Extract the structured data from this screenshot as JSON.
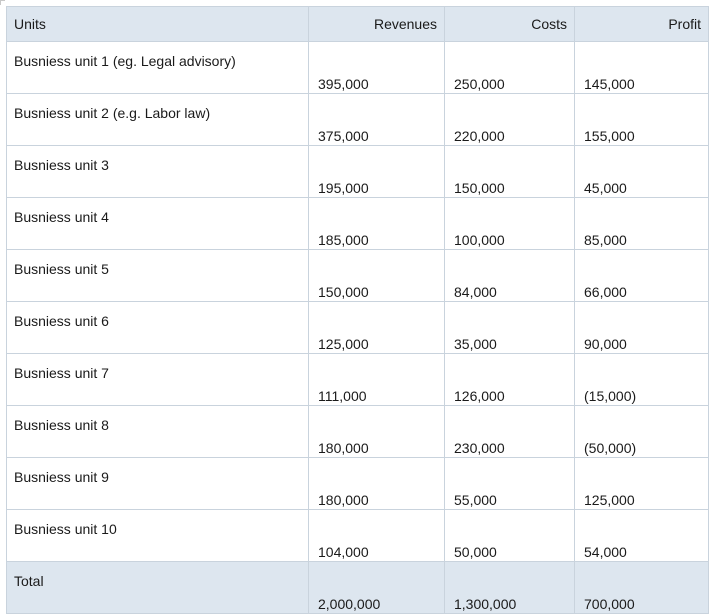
{
  "table": {
    "headers": {
      "units": "Units",
      "revenues": "Revenues",
      "costs": "Costs",
      "profit": "Profit"
    },
    "rows": [
      {
        "unit": "Busniess unit 1 (eg. Legal advisory)",
        "revenues": "395,000",
        "costs": "250,000",
        "profit": "145,000"
      },
      {
        "unit": "Busniess unit 2 (e.g. Labor law)",
        "revenues": "375,000",
        "costs": "220,000",
        "profit": "155,000"
      },
      {
        "unit": "Busniess unit 3",
        "revenues": "195,000",
        "costs": "150,000",
        "profit": "45,000"
      },
      {
        "unit": "Busniess unit 4",
        "revenues": "185,000",
        "costs": "100,000",
        "profit": "85,000"
      },
      {
        "unit": "Busniess unit 5",
        "revenues": "150,000",
        "costs": "84,000",
        "profit": "66,000"
      },
      {
        "unit": "Busniess unit 6",
        "revenues": "125,000",
        "costs": "35,000",
        "profit": "90,000"
      },
      {
        "unit": "Busniess unit 7",
        "revenues": "111,000",
        "costs": "126,000",
        "profit": "(15,000)"
      },
      {
        "unit": "Busniess unit 8",
        "revenues": "180,000",
        "costs": "230,000",
        "profit": "(50,000)"
      },
      {
        "unit": "Busniess unit 9",
        "revenues": "180,000",
        "costs": "55,000",
        "profit": "125,000"
      },
      {
        "unit": "Busniess unit 10",
        "revenues": "104,000",
        "costs": "50,000",
        "profit": "54,000"
      }
    ],
    "total": {
      "label": "Total",
      "revenues": "2,000,000",
      "costs": "1,300,000",
      "profit": "700,000"
    }
  },
  "colors": {
    "header_fill": "#dde6ef",
    "grid_line": "#c9d3dd",
    "text": "#1a1a1a"
  }
}
